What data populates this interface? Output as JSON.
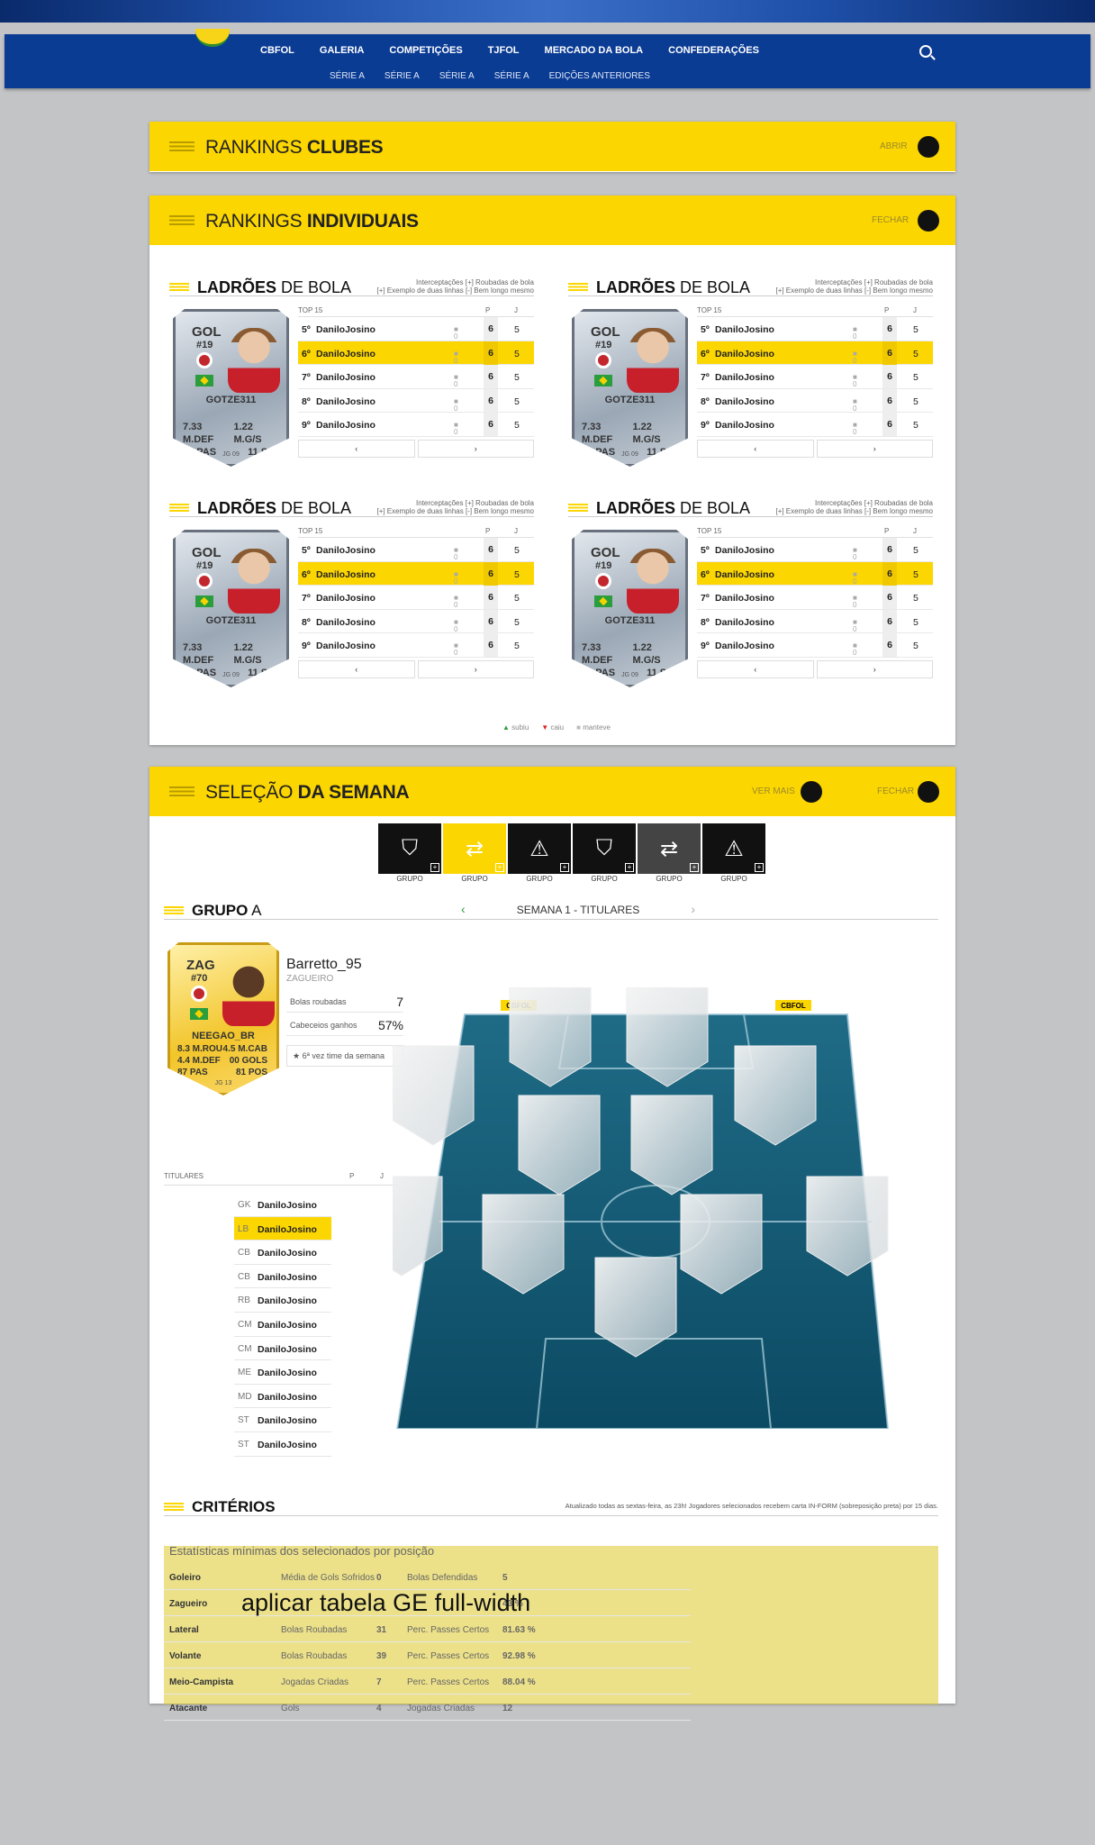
{
  "nav": {
    "main": [
      "CBFOL",
      "GALERIA",
      "COMPETIÇÕES",
      "TJFOL",
      "MERCADO DA BOLA",
      "CONFEDERAÇÕES"
    ],
    "sub": [
      "SÉRIE A",
      "SÉRIE A",
      "SÉRIE A",
      "SÉRIE A",
      "EDIÇÕES ANTERIORES"
    ]
  },
  "rankings_clubes": {
    "title_light": "RANKINGS ",
    "title_bold": "CLUBES",
    "action": "ABRIR"
  },
  "rankings_individuais": {
    "title_light": "RANKINGS ",
    "title_bold": "INDIVIDUAIS",
    "action": "FECHAR",
    "card": {
      "title_bold": "LADRÕES",
      "title_rest": " DE BOLA",
      "note_line1": "Interceptações [+] Roubadas de bola",
      "note_line2": "[+] Exemplo de duas linhas [-] Bem longo mesmo",
      "player": {
        "pos": "GOL",
        "num": "#19",
        "name": "GOTZE311",
        "stat1": "7.33 M.DEF",
        "stat2": "1.22 M.G/S",
        "stat3": "57 PAS",
        "stat4": "11 SSG",
        "foot": "JG 09"
      },
      "table_head": {
        "top": "TOP 15",
        "p": "P",
        "j": "J"
      },
      "rows": [
        {
          "pos": "5º",
          "name": "DaniloJosino",
          "mv": "0",
          "p": "6",
          "j": "5"
        },
        {
          "pos": "6º",
          "name": "DaniloJosino",
          "mv": "0",
          "p": "6",
          "j": "5"
        },
        {
          "pos": "7º",
          "name": "DaniloJosino",
          "mv": "0",
          "p": "6",
          "j": "5"
        },
        {
          "pos": "8º",
          "name": "DaniloJosino",
          "mv": "0",
          "p": "6",
          "j": "5"
        },
        {
          "pos": "9º",
          "name": "DaniloJosino",
          "mv": "0",
          "p": "6",
          "j": "5"
        }
      ],
      "prev": "‹",
      "next": "›"
    },
    "legend": [
      "subiu",
      "caiu",
      "manteve"
    ]
  },
  "selecao": {
    "title_light": "SELEÇÃO ",
    "title_bold": "DA SEMANA",
    "action_more": "VER MAIS",
    "action_close": "FECHAR",
    "tiles": [
      {
        "label": "GRUPO",
        "icon": "shield-icon",
        "glyph": "⛉",
        "bg": "#111"
      },
      {
        "label": "GRUPO",
        "icon": "swap-icon",
        "glyph": "⇄",
        "bg": "#fcd601"
      },
      {
        "label": "GRUPO",
        "icon": "warning-icon",
        "glyph": "⚠",
        "bg": "#111"
      },
      {
        "label": "GRUPO",
        "icon": "shield-icon",
        "glyph": "⛉",
        "bg": "#111"
      },
      {
        "label": "GRUPO",
        "icon": "swap-icon",
        "glyph": "⇄",
        "bg": "#444"
      },
      {
        "label": "GRUPO",
        "icon": "warning-icon",
        "glyph": "⚠",
        "bg": "#111"
      }
    ],
    "group_bold": "GRUPO",
    "group_rest": " A",
    "week": "SEMANA 1 - TITULARES",
    "player": {
      "pos": "ZAG",
      "num": "#70",
      "name": "NEEGAO_BR",
      "stat1": "8.3 M.ROU",
      "stat2": "4.5 M.CAB",
      "stat3": "4.4 M.DEF",
      "stat4": "00 GOLS",
      "stat5": "87 PAS",
      "stat6": "81 POS",
      "foot": "JG 13"
    },
    "info": {
      "name": "Barretto_95",
      "pos": "ZAGUEIRO",
      "k1": "Bolas roubadas",
      "v1": "7",
      "k2": "Cabeceios ganhos",
      "v2": "57%",
      "star": "6ª vez time da semana"
    },
    "titulares_head": {
      "label": "TITULARES",
      "p": "P",
      "j": "J"
    },
    "titulares": [
      {
        "pos": "GK",
        "name": "DaniloJosino"
      },
      {
        "pos": "LB",
        "name": "DaniloJosino"
      },
      {
        "pos": "CB",
        "name": "DaniloJosino"
      },
      {
        "pos": "CB",
        "name": "DaniloJosino"
      },
      {
        "pos": "RB",
        "name": "DaniloJosino"
      },
      {
        "pos": "CM",
        "name": "DaniloJosino"
      },
      {
        "pos": "CM",
        "name": "DaniloJosino"
      },
      {
        "pos": "ME",
        "name": "DaniloJosino"
      },
      {
        "pos": "MD",
        "name": "DaniloJosino"
      },
      {
        "pos": "ST",
        "name": "DaniloJosino"
      },
      {
        "pos": "ST",
        "name": "DaniloJosino"
      }
    ],
    "pitch_logo": "CBFOL"
  },
  "criterios": {
    "title": "CRITÉRIOS",
    "note": "Atualizado todas as sextas-feira, as 23h! Jogadores selecionados recebem carta IN-FORM (sobreposição preta) por 15 dias.",
    "subtitle": "Estatísticas mínimas dos selecionados por posição",
    "rows": [
      [
        "Goleiro",
        "Média de Gols Sofridos",
        "0",
        "Bolas Defendidas",
        "5"
      ],
      [
        "Zagueiro",
        "",
        "",
        "",
        "43 %"
      ],
      [
        "Lateral",
        "Bolas Roubadas",
        "31",
        "Perc. Passes Certos",
        "81.63 %"
      ],
      [
        "Volante",
        "Bolas Roubadas",
        "39",
        "Perc. Passes Certos",
        "92.98 %"
      ],
      [
        "Meio-Campista",
        "Jogadas Criadas",
        "7",
        "Perc. Passes Certos",
        "88.04 %"
      ],
      [
        "Atacante",
        "Gols",
        "4",
        "Jogadas Criadas",
        "12"
      ]
    ],
    "overlay_text": "aplicar tabela GE full-width"
  }
}
